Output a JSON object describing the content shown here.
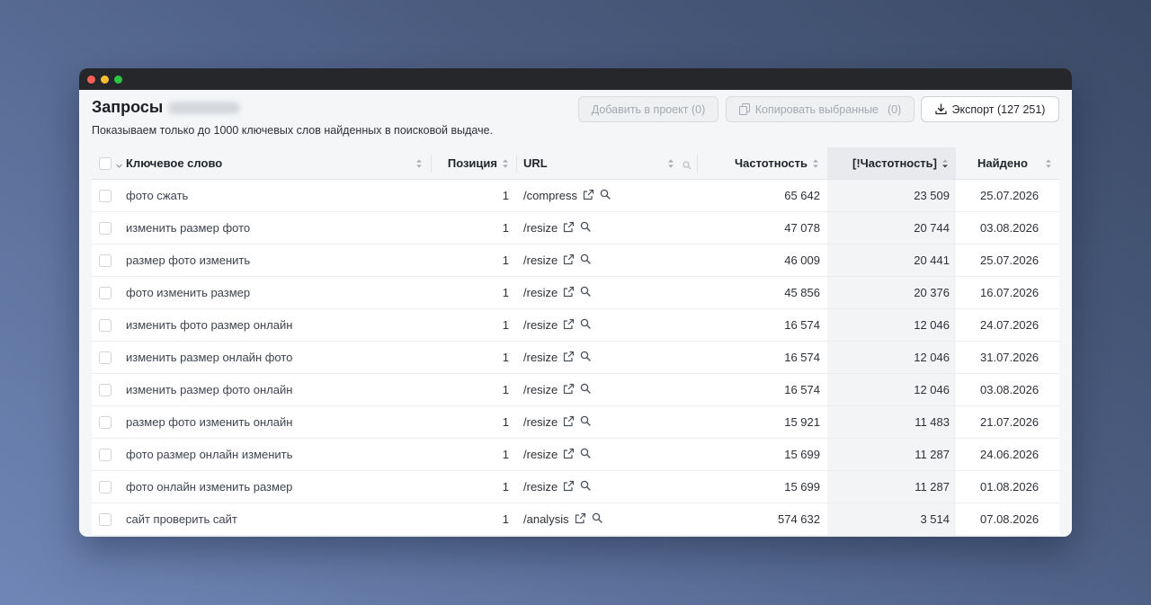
{
  "window": {
    "title_dots": [
      "close",
      "minimize",
      "maximize"
    ]
  },
  "header": {
    "title": "Запросы",
    "subtitle": "Показываем только до 1000 ключевых слов найденных в поисковой выдаче."
  },
  "toolbar": {
    "add_label": "Добавить в проект (0)",
    "copy_label": "Копировать выбранные",
    "copy_count": "(0)",
    "export_label": "Экспорт (127 251)"
  },
  "table": {
    "columns": {
      "keyword": "Ключевое слово",
      "position": "Позиция",
      "url": "URL",
      "frequency": "Частотность",
      "exact_frequency": "[!Частотность]",
      "found": "Найдено"
    },
    "rows": [
      {
        "keyword": "фото сжать",
        "position": "1",
        "url": "/compress",
        "frequency": "65 642",
        "exact_frequency": "23 509",
        "found": "25.07.2026"
      },
      {
        "keyword": "изменить размер фото",
        "position": "1",
        "url": "/resize",
        "frequency": "47 078",
        "exact_frequency": "20 744",
        "found": "03.08.2026"
      },
      {
        "keyword": "размер фото изменить",
        "position": "1",
        "url": "/resize",
        "frequency": "46 009",
        "exact_frequency": "20 441",
        "found": "25.07.2026"
      },
      {
        "keyword": "фото изменить размер",
        "position": "1",
        "url": "/resize",
        "frequency": "45 856",
        "exact_frequency": "20 376",
        "found": "16.07.2026"
      },
      {
        "keyword": "изменить фото размер онлайн",
        "position": "1",
        "url": "/resize",
        "frequency": "16 574",
        "exact_frequency": "12 046",
        "found": "24.07.2026"
      },
      {
        "keyword": "изменить размер онлайн фото",
        "position": "1",
        "url": "/resize",
        "frequency": "16 574",
        "exact_frequency": "12 046",
        "found": "31.07.2026"
      },
      {
        "keyword": "изменить размер фото онлайн",
        "position": "1",
        "url": "/resize",
        "frequency": "16 574",
        "exact_frequency": "12 046",
        "found": "03.08.2026"
      },
      {
        "keyword": "размер фото изменить онлайн",
        "position": "1",
        "url": "/resize",
        "frequency": "15 921",
        "exact_frequency": "11 483",
        "found": "21.07.2026"
      },
      {
        "keyword": "фото размер онлайн изменить",
        "position": "1",
        "url": "/resize",
        "frequency": "15 699",
        "exact_frequency": "11 287",
        "found": "24.06.2026"
      },
      {
        "keyword": "фото онлайн изменить размер",
        "position": "1",
        "url": "/resize",
        "frequency": "15 699",
        "exact_frequency": "11 287",
        "found": "01.08.2026"
      },
      {
        "keyword": "сайт проверить сайт",
        "position": "1",
        "url": "/analysis",
        "frequency": "574 632",
        "exact_frequency": "3 514",
        "found": "07.08.2026"
      }
    ]
  },
  "icons": {
    "sort": "sort-updown-icon",
    "external": "external-link-icon",
    "search": "search-icon",
    "copy": "copy-icon",
    "download": "download-icon"
  }
}
